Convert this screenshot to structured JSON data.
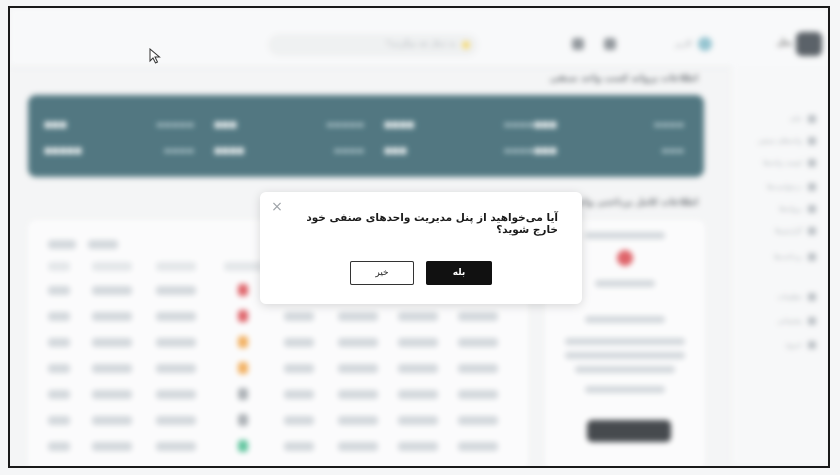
{
  "header": {
    "search_placeholder": "به دنبال چه میگردید؟",
    "user_name": "کاربر",
    "logo_text": "پنل"
  },
  "sidebar": {
    "items": [
      {
        "label": "خانه"
      },
      {
        "label": "واحدهای صنفی"
      },
      {
        "label": "لیست واحدها"
      },
      {
        "label": "درخواست‌ها"
      },
      {
        "label": "پروانه‌ها"
      },
      {
        "label": "گزارش‌ها"
      },
      {
        "label": "پرداخت‌ها"
      },
      {
        "label": "تنظیمات"
      },
      {
        "label": "پشتیبانی"
      },
      {
        "label": "خروج"
      }
    ]
  },
  "sections": {
    "stats_title": "اطلاعات پروانه کسب واحد صنفی",
    "table_title": "اطلاعات کامل پرداختی واحد صنفی"
  },
  "modal": {
    "message": "آیا می‌خواهید از پنل مدیریت واحدهای صنفی خود خارج شوید؟",
    "confirm_label": "بله",
    "cancel_label": "خیر",
    "close_glyph": "×"
  },
  "colors": {
    "banner": "#2c5a66",
    "confirm_button": "#111111",
    "status_red": "#d8434a",
    "status_orange": "#f0a040",
    "status_gray": "#9aa0a6",
    "status_green": "#3fb98a"
  },
  "table_status_rows": [
    "red",
    "red",
    "orange",
    "orange",
    "gray",
    "gray",
    "green"
  ]
}
